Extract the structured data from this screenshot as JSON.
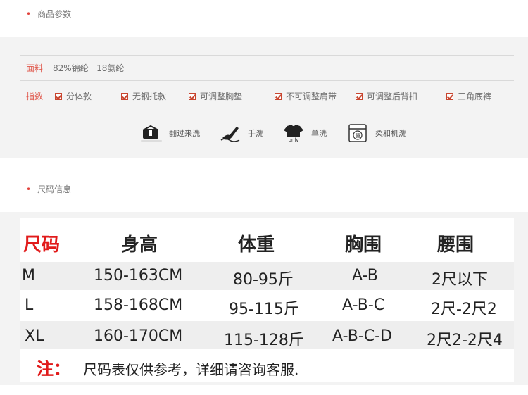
{
  "section1": {
    "title": "商品参数"
  },
  "material": {
    "label": "面料",
    "value": "82%锦纶   18氨纶"
  },
  "index": {
    "label": "指数",
    "options": [
      "分体款",
      "无钢托款",
      "可调整胸垫",
      "不可调整肩带",
      "可调整后背扣",
      "三角底裤"
    ]
  },
  "care": [
    {
      "icon": "turn-inside-out-icon",
      "label": "翻过来洗"
    },
    {
      "icon": "hand-wash-icon",
      "label": "手洗"
    },
    {
      "icon": "wash-separately-icon",
      "label": "单洗",
      "sub": "only"
    },
    {
      "icon": "gentle-machine-wash-icon",
      "label": "柔和机洗",
      "sub": "弱"
    }
  ],
  "section2": {
    "title": "尺码信息"
  },
  "size_table": {
    "headers": [
      "尺码",
      "身高",
      "体重",
      "胸围",
      "腰围"
    ],
    "rows": [
      [
        "M",
        "150-163CM",
        "80-95斤",
        "A-B",
        "2尺以下"
      ],
      [
        "L",
        "158-168CM",
        "95-115斤",
        "A-B-C",
        "2尺-2尺2"
      ],
      [
        "XL",
        "160-170CM",
        "115-128斤",
        "A-B-C-D",
        "2尺2-2尺4"
      ]
    ]
  },
  "note": {
    "label": "注：",
    "text": "尺码表仅供参考，详细请咨询客服."
  },
  "colors": {
    "accent": "#e2423c",
    "header_red": "#e11b1b",
    "panel_bg": "#f3f3f3"
  }
}
